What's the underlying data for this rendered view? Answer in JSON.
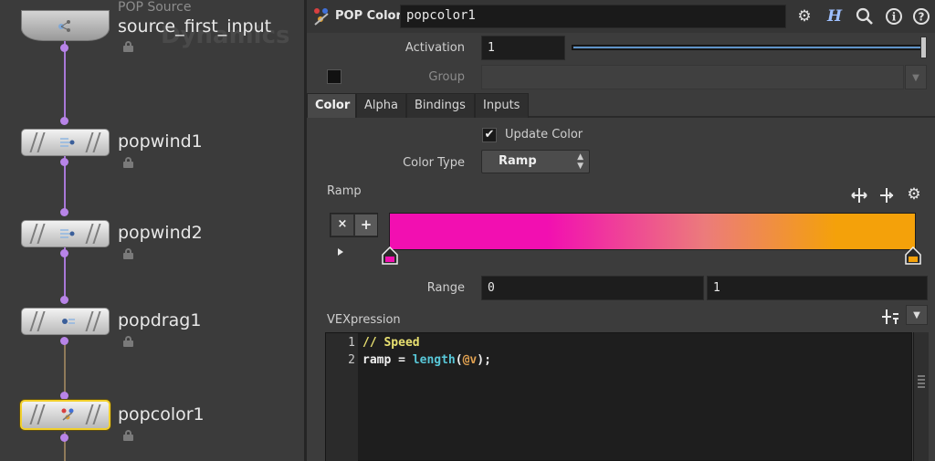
{
  "network": {
    "background_text": "Dynamics",
    "source_node": {
      "type": "POP Source",
      "name": "source_first_input"
    },
    "nodes": [
      {
        "name": "popwind1"
      },
      {
        "name": "popwind2"
      },
      {
        "name": "popdrag1"
      },
      {
        "name": "popcolor1",
        "selected": true
      }
    ]
  },
  "header": {
    "node_type": "POP Color",
    "node_name": "popcolor1",
    "buttons": [
      "gear-icon",
      "help-h-icon",
      "search-icon",
      "info-icon",
      "question-icon"
    ]
  },
  "params": {
    "activation": {
      "label": "Activation",
      "value": "1",
      "slider_fraction": 1.0
    },
    "group": {
      "label": "Group",
      "value": ""
    },
    "tabs": [
      {
        "label": "Color",
        "active": true
      },
      {
        "label": "Alpha",
        "active": false
      },
      {
        "label": "Bindings",
        "active": false
      },
      {
        "label": "Inputs",
        "active": false
      }
    ],
    "update_color": {
      "label": "Update Color",
      "checked": true
    },
    "color_type": {
      "label": "Color Type",
      "value": "Ramp"
    },
    "ramp": {
      "label": "Ramp",
      "remove_label": "×",
      "add_label": "+",
      "colors": [
        "#f20fb1",
        "#f4a10a"
      ],
      "keys": [
        {
          "position": 0.0,
          "color": "#f20fb1"
        },
        {
          "position": 1.0,
          "color": "#f4a10a"
        }
      ]
    },
    "range": {
      "label": "Range",
      "min": "0",
      "max": "1"
    },
    "vexpression": {
      "label": "VEXpression",
      "lines": [
        {
          "num": "1",
          "text": "// Speed"
        },
        {
          "num": "2",
          "parts": [
            "ramp = ",
            "length",
            "(",
            "@v",
            ");"
          ]
        }
      ],
      "colors": {
        "comment": "#e8e070",
        "code": "#f0f0f0",
        "function": "#58c7d8",
        "attribute": "#e0a050"
      }
    }
  }
}
